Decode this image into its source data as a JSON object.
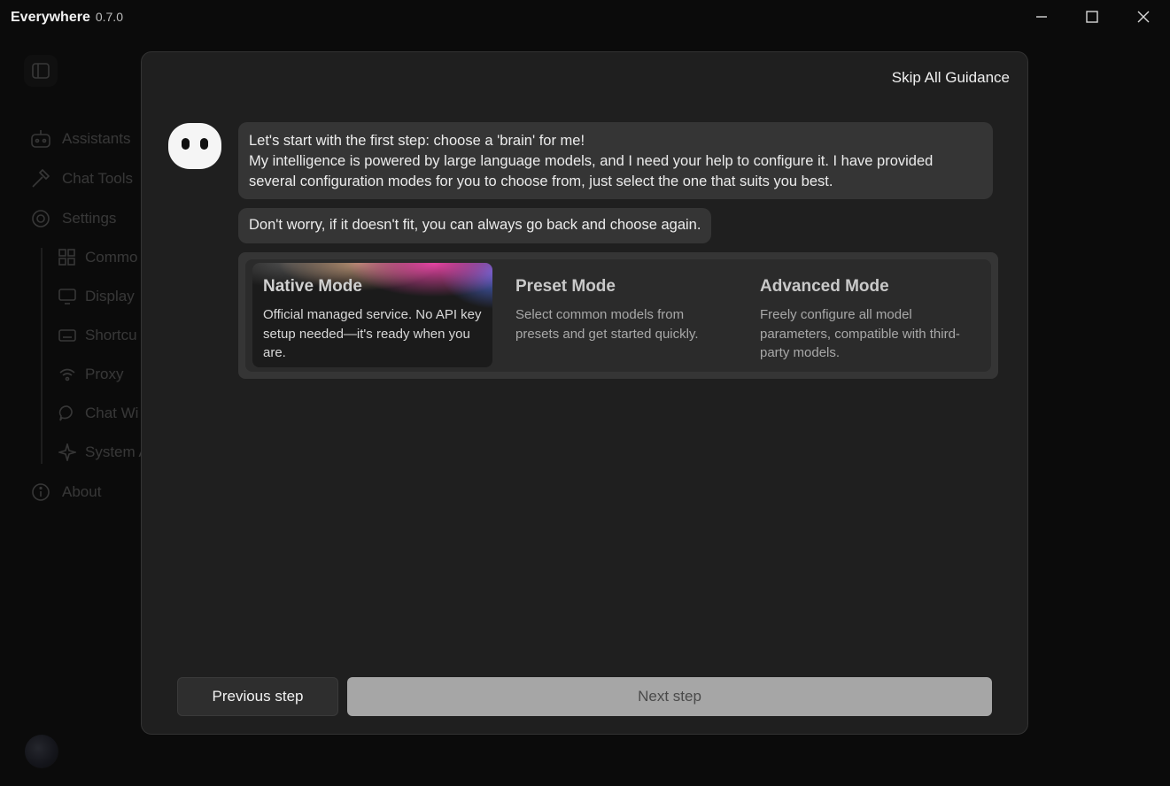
{
  "titlebar": {
    "app_name": "Everywhere",
    "version": "0.7.0"
  },
  "sidebar": {
    "items": [
      {
        "label": "Assistants",
        "icon": "robot-icon"
      },
      {
        "label": "Chat Tools",
        "icon": "hammer-icon"
      },
      {
        "label": "Settings",
        "icon": "gear-icon"
      },
      {
        "label": "Commo",
        "icon": "grid-icon"
      },
      {
        "label": "Display",
        "icon": "monitor-icon"
      },
      {
        "label": "Shortcu",
        "icon": "keyboard-icon"
      },
      {
        "label": "Proxy",
        "icon": "wifi-icon"
      },
      {
        "label": "Chat Wi",
        "icon": "chat-icon"
      },
      {
        "label": "System A",
        "icon": "sparkle-icon"
      },
      {
        "label": "About",
        "icon": "info-icon"
      }
    ]
  },
  "modal": {
    "skip_label": "Skip All Guidance",
    "message_1_line_1": "Let's start with the first step: choose a 'brain' for me!",
    "message_1_line_2": "My intelligence is powered by large language models, and I need your help to configure it. I have provided several configuration modes for you to choose from, just select the one that suits you best.",
    "message_2": "Don't worry, if it doesn't fit, you can always go back and choose again.",
    "modes": [
      {
        "title": "Native Mode",
        "description": "Official managed service. No API key setup needed—it's ready when you are."
      },
      {
        "title": "Preset Mode",
        "description": "Select common models from presets and get started quickly."
      },
      {
        "title": "Advanced Mode",
        "description": "Freely configure all model parameters, compatible with third-party models."
      }
    ],
    "prev_label": "Previous step",
    "next_label": "Next step"
  }
}
